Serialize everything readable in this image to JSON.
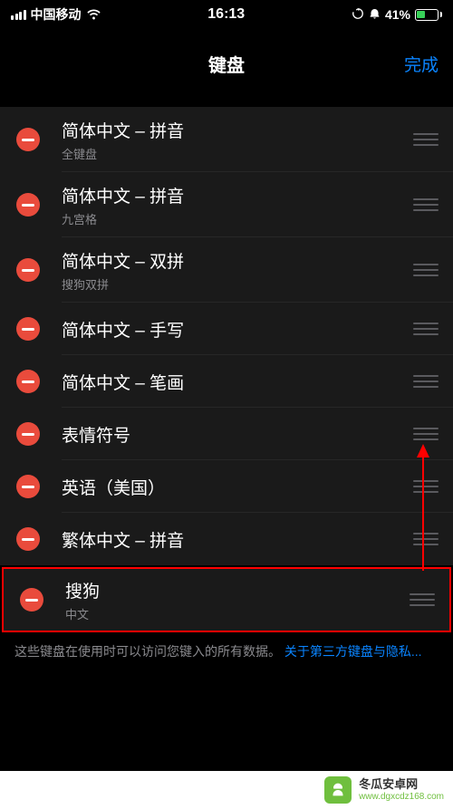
{
  "status": {
    "carrier": "中国移动",
    "time": "16:13",
    "battery_pct": "41%"
  },
  "nav": {
    "title": "键盘",
    "done": "完成"
  },
  "keyboards": [
    {
      "title": "简体中文 – 拼音",
      "sub": "全键盘"
    },
    {
      "title": "简体中文 – 拼音",
      "sub": "九宫格"
    },
    {
      "title": "简体中文 – 双拼",
      "sub": "搜狗双拼"
    },
    {
      "title": "简体中文 – 手写",
      "sub": ""
    },
    {
      "title": "简体中文 – 笔画",
      "sub": ""
    },
    {
      "title": "表情符号",
      "sub": ""
    },
    {
      "title": "英语（美国）",
      "sub": ""
    },
    {
      "title": "繁体中文 – 拼音",
      "sub": ""
    },
    {
      "title": "搜狗",
      "sub": "中文"
    }
  ],
  "footer": {
    "text": "这些键盘在使用时可以访问您键入的所有数据。",
    "link": "关于第三方键盘与隐私..."
  },
  "watermark": {
    "name": "冬瓜安卓网",
    "url": "www.dgxcdz168.com"
  }
}
